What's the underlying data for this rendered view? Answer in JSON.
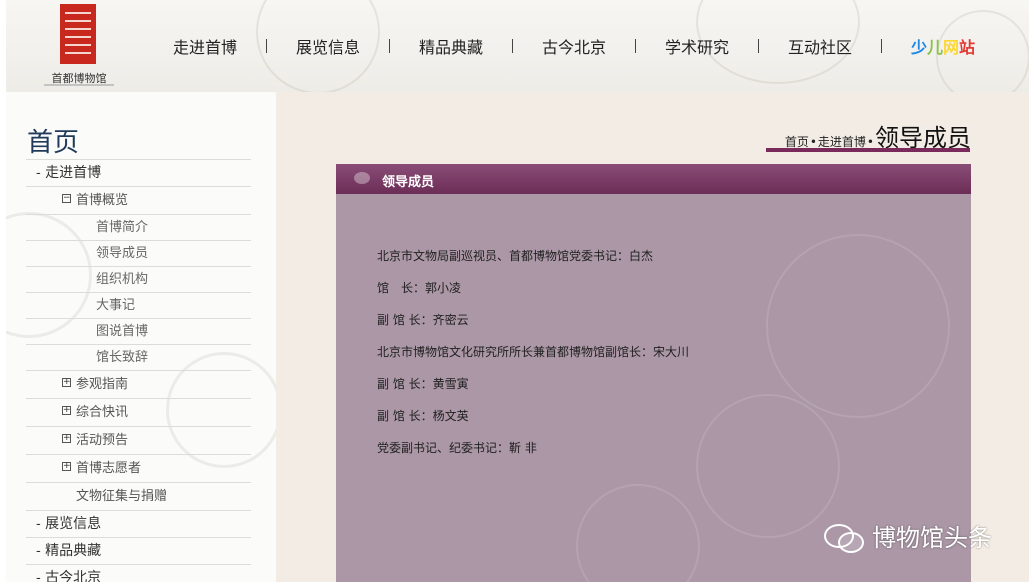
{
  "header": {
    "logo_text": "首都博物馆",
    "nav": [
      {
        "label": "走进首博"
      },
      {
        "label": "展览信息"
      },
      {
        "label": "精品典藏"
      },
      {
        "label": "古今北京"
      },
      {
        "label": "学术研究"
      },
      {
        "label": "互动社区"
      }
    ],
    "kids": {
      "chars": [
        "少",
        "儿",
        "网",
        "站"
      ],
      "colors": [
        "#1e88e5",
        "#8bc34a",
        "#fdd835",
        "#e53935"
      ]
    }
  },
  "sidebar": {
    "title": "首页",
    "items": [
      {
        "label": "- 走进首博",
        "level": 1
      },
      {
        "label": "首博概览",
        "level": 2,
        "box": "−"
      },
      {
        "label": "首博简介",
        "level": 3
      },
      {
        "label": "领导成员",
        "level": 3
      },
      {
        "label": "组织机构",
        "level": 3
      },
      {
        "label": "大事记",
        "level": 3
      },
      {
        "label": "图说首博",
        "level": 3
      },
      {
        "label": "馆长致辞",
        "level": 3
      },
      {
        "label": "参观指南",
        "level": 2,
        "box": "+"
      },
      {
        "label": "综合快讯",
        "level": 2,
        "box": "+"
      },
      {
        "label": "活动预告",
        "level": 2,
        "box": "+"
      },
      {
        "label": "首博志愿者",
        "level": 2,
        "box": "+"
      },
      {
        "label": "文物征集与捐赠",
        "level": 2
      },
      {
        "label": "- 展览信息",
        "level": 1
      },
      {
        "label": "- 精品典藏",
        "level": 1
      },
      {
        "label": "- 古今北京",
        "level": 1
      }
    ]
  },
  "breadcrumb": {
    "home": "首页",
    "parent": "走进首博",
    "current": "领导成员",
    "sep": "•"
  },
  "panel": {
    "title": "领导成员",
    "entries": [
      "北京市文物局副巡视员、首都博物馆党委书记：白杰",
      "馆　长：郭小凌",
      "副 馆 长：齐密云",
      "北京市博物馆文化研究所所长兼首都博物馆副馆长：宋大川",
      "副 馆 长：黄雪寅",
      "副 馆 长：杨文英",
      "党委副书记、纪委书记：靳 非"
    ]
  },
  "watermark": {
    "text": "博物馆头条",
    "icon": "wechat-icon"
  }
}
